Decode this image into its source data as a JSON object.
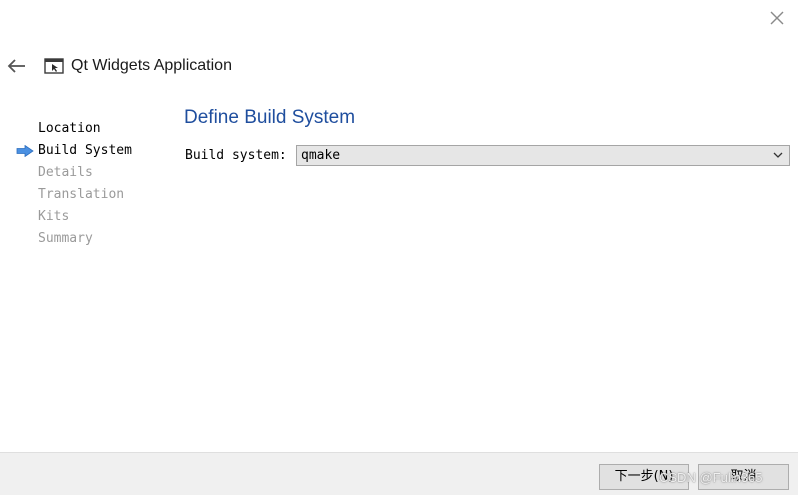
{
  "window": {
    "title": "Qt Widgets Application"
  },
  "icons": {
    "close": "close-icon",
    "back": "back-arrow-icon",
    "app": "qt-application-icon",
    "current_step": "arrow-right-icon",
    "dropdown": "chevron-down-icon"
  },
  "steps": [
    {
      "label": "Location",
      "state": "done"
    },
    {
      "label": "Build System",
      "state": "current"
    },
    {
      "label": "Details",
      "state": "pending"
    },
    {
      "label": "Translation",
      "state": "pending"
    },
    {
      "label": "Kits",
      "state": "pending"
    },
    {
      "label": "Summary",
      "state": "pending"
    }
  ],
  "page": {
    "title": "Define Build System",
    "build_system_label": "Build system:",
    "build_system_value": "qmake"
  },
  "footer": {
    "next_label": "下一步(N)",
    "cancel_label": "取消"
  },
  "watermark": "CSDN @Fulin365",
  "colors": {
    "page_title": "#1f4e9e",
    "step_arrow": "#4a90e2",
    "step_pending": "#9a9a9a",
    "combo_bg": "#e6e6e6",
    "footer_bg": "#f0f0f0"
  }
}
